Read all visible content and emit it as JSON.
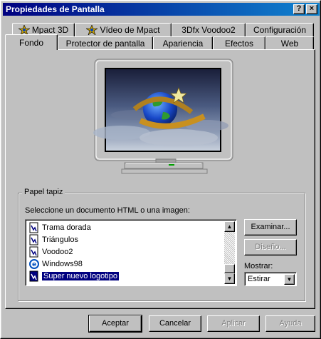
{
  "window": {
    "title": "Propiedades de Pantalla",
    "help_button": "?",
    "close_button": "×"
  },
  "tabs_row1": [
    {
      "label": "Mpact 3D",
      "icon": "mpact-icon"
    },
    {
      "label": "Vídeo de Mpact",
      "icon": "mpact-icon"
    },
    {
      "label": "3Dfx Voodoo2",
      "icon": ""
    },
    {
      "label": "Configuración",
      "icon": ""
    }
  ],
  "tabs_row2": [
    {
      "label": "Fondo",
      "active": true
    },
    {
      "label": "Protector de pantalla"
    },
    {
      "label": "Apariencia"
    },
    {
      "label": "Efectos"
    },
    {
      "label": "Web"
    }
  ],
  "wallpaper": {
    "group_title": "Papel tapiz",
    "prompt": "Seleccione un documento HTML o una imagen:",
    "items": [
      {
        "label": "Trama dorada",
        "icon": "bitmap-file-icon"
      },
      {
        "label": "Triángulos",
        "icon": "bitmap-file-icon"
      },
      {
        "label": "Voodoo2",
        "icon": "bitmap-file-icon"
      },
      {
        "label": "Windows98",
        "icon": "html-document-icon"
      },
      {
        "label": "Super nuevo logotipo",
        "icon": "bitmap-file-icon",
        "selected": true
      }
    ],
    "browse_button": "Examinar...",
    "design_button": "Diseño...",
    "display_label": "Mostrar:",
    "display_value": "Estirar"
  },
  "footer": {
    "ok": "Aceptar",
    "cancel": "Cancelar",
    "apply": "Aplicar",
    "help": "Ayuda"
  },
  "colors": {
    "face": "#c0c0c0",
    "title_start": "#000080",
    "title_end": "#1084d0",
    "selection": "#000080"
  }
}
